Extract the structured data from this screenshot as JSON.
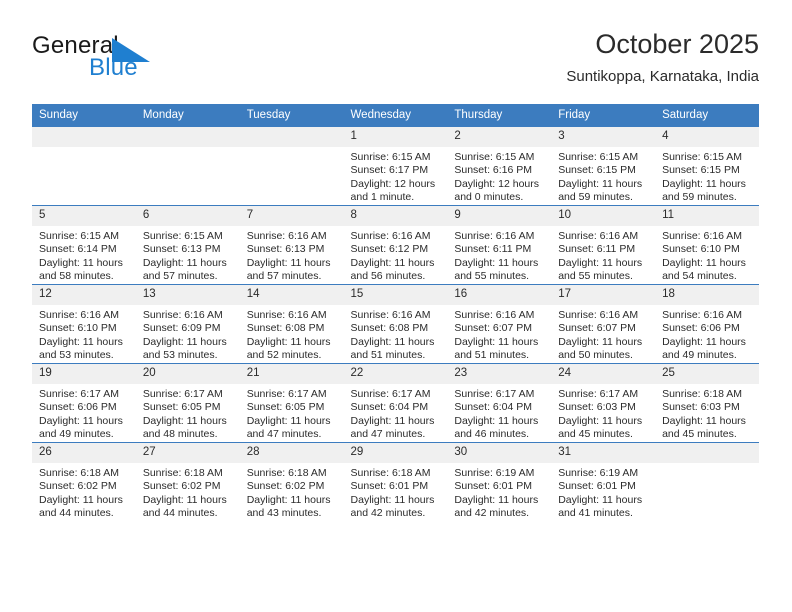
{
  "brand": {
    "word1": "General",
    "word2": "Blue",
    "triangle_color": "#1f7fd0",
    "word1_color": "#1a1a1a",
    "word2_color": "#1f7fd0"
  },
  "header": {
    "title": "October 2025",
    "subtitle": "Suntikoppa, Karnataka, India"
  },
  "theme": {
    "header_bg": "#3c7cbf",
    "header_text": "#ffffff",
    "daynum_bg": "#f0f0f0",
    "cell_bg": "#ffffff",
    "separator": "#3c7cbf",
    "text": "#2b2b2b"
  },
  "weekday_headers": [
    "Sunday",
    "Monday",
    "Tuesday",
    "Wednesday",
    "Thursday",
    "Friday",
    "Saturday"
  ],
  "labels": {
    "sunrise_prefix": "Sunrise:",
    "sunset_prefix": "Sunset:",
    "daylight_prefix": "Daylight:"
  },
  "weeks": [
    [
      {
        "day": "",
        "blank": true,
        "sunrise": "",
        "sunset": "",
        "daylight": ""
      },
      {
        "day": "",
        "blank": true,
        "sunrise": "",
        "sunset": "",
        "daylight": ""
      },
      {
        "day": "",
        "blank": true,
        "sunrise": "",
        "sunset": "",
        "daylight": ""
      },
      {
        "day": "1",
        "blank": false,
        "sunrise": "Sunrise: 6:15 AM",
        "sunset": "Sunset: 6:17 PM",
        "daylight": "Daylight: 12 hours and 1 minute."
      },
      {
        "day": "2",
        "blank": false,
        "sunrise": "Sunrise: 6:15 AM",
        "sunset": "Sunset: 6:16 PM",
        "daylight": "Daylight: 12 hours and 0 minutes."
      },
      {
        "day": "3",
        "blank": false,
        "sunrise": "Sunrise: 6:15 AM",
        "sunset": "Sunset: 6:15 PM",
        "daylight": "Daylight: 11 hours and 59 minutes."
      },
      {
        "day": "4",
        "blank": false,
        "sunrise": "Sunrise: 6:15 AM",
        "sunset": "Sunset: 6:15 PM",
        "daylight": "Daylight: 11 hours and 59 minutes."
      }
    ],
    [
      {
        "day": "5",
        "blank": false,
        "sunrise": "Sunrise: 6:15 AM",
        "sunset": "Sunset: 6:14 PM",
        "daylight": "Daylight: 11 hours and 58 minutes."
      },
      {
        "day": "6",
        "blank": false,
        "sunrise": "Sunrise: 6:15 AM",
        "sunset": "Sunset: 6:13 PM",
        "daylight": "Daylight: 11 hours and 57 minutes."
      },
      {
        "day": "7",
        "blank": false,
        "sunrise": "Sunrise: 6:16 AM",
        "sunset": "Sunset: 6:13 PM",
        "daylight": "Daylight: 11 hours and 57 minutes."
      },
      {
        "day": "8",
        "blank": false,
        "sunrise": "Sunrise: 6:16 AM",
        "sunset": "Sunset: 6:12 PM",
        "daylight": "Daylight: 11 hours and 56 minutes."
      },
      {
        "day": "9",
        "blank": false,
        "sunrise": "Sunrise: 6:16 AM",
        "sunset": "Sunset: 6:11 PM",
        "daylight": "Daylight: 11 hours and 55 minutes."
      },
      {
        "day": "10",
        "blank": false,
        "sunrise": "Sunrise: 6:16 AM",
        "sunset": "Sunset: 6:11 PM",
        "daylight": "Daylight: 11 hours and 55 minutes."
      },
      {
        "day": "11",
        "blank": false,
        "sunrise": "Sunrise: 6:16 AM",
        "sunset": "Sunset: 6:10 PM",
        "daylight": "Daylight: 11 hours and 54 minutes."
      }
    ],
    [
      {
        "day": "12",
        "blank": false,
        "sunrise": "Sunrise: 6:16 AM",
        "sunset": "Sunset: 6:10 PM",
        "daylight": "Daylight: 11 hours and 53 minutes."
      },
      {
        "day": "13",
        "blank": false,
        "sunrise": "Sunrise: 6:16 AM",
        "sunset": "Sunset: 6:09 PM",
        "daylight": "Daylight: 11 hours and 53 minutes."
      },
      {
        "day": "14",
        "blank": false,
        "sunrise": "Sunrise: 6:16 AM",
        "sunset": "Sunset: 6:08 PM",
        "daylight": "Daylight: 11 hours and 52 minutes."
      },
      {
        "day": "15",
        "blank": false,
        "sunrise": "Sunrise: 6:16 AM",
        "sunset": "Sunset: 6:08 PM",
        "daylight": "Daylight: 11 hours and 51 minutes."
      },
      {
        "day": "16",
        "blank": false,
        "sunrise": "Sunrise: 6:16 AM",
        "sunset": "Sunset: 6:07 PM",
        "daylight": "Daylight: 11 hours and 51 minutes."
      },
      {
        "day": "17",
        "blank": false,
        "sunrise": "Sunrise: 6:16 AM",
        "sunset": "Sunset: 6:07 PM",
        "daylight": "Daylight: 11 hours and 50 minutes."
      },
      {
        "day": "18",
        "blank": false,
        "sunrise": "Sunrise: 6:16 AM",
        "sunset": "Sunset: 6:06 PM",
        "daylight": "Daylight: 11 hours and 49 minutes."
      }
    ],
    [
      {
        "day": "19",
        "blank": false,
        "sunrise": "Sunrise: 6:17 AM",
        "sunset": "Sunset: 6:06 PM",
        "daylight": "Daylight: 11 hours and 49 minutes."
      },
      {
        "day": "20",
        "blank": false,
        "sunrise": "Sunrise: 6:17 AM",
        "sunset": "Sunset: 6:05 PM",
        "daylight": "Daylight: 11 hours and 48 minutes."
      },
      {
        "day": "21",
        "blank": false,
        "sunrise": "Sunrise: 6:17 AM",
        "sunset": "Sunset: 6:05 PM",
        "daylight": "Daylight: 11 hours and 47 minutes."
      },
      {
        "day": "22",
        "blank": false,
        "sunrise": "Sunrise: 6:17 AM",
        "sunset": "Sunset: 6:04 PM",
        "daylight": "Daylight: 11 hours and 47 minutes."
      },
      {
        "day": "23",
        "blank": false,
        "sunrise": "Sunrise: 6:17 AM",
        "sunset": "Sunset: 6:04 PM",
        "daylight": "Daylight: 11 hours and 46 minutes."
      },
      {
        "day": "24",
        "blank": false,
        "sunrise": "Sunrise: 6:17 AM",
        "sunset": "Sunset: 6:03 PM",
        "daylight": "Daylight: 11 hours and 45 minutes."
      },
      {
        "day": "25",
        "blank": false,
        "sunrise": "Sunrise: 6:18 AM",
        "sunset": "Sunset: 6:03 PM",
        "daylight": "Daylight: 11 hours and 45 minutes."
      }
    ],
    [
      {
        "day": "26",
        "blank": false,
        "sunrise": "Sunrise: 6:18 AM",
        "sunset": "Sunset: 6:02 PM",
        "daylight": "Daylight: 11 hours and 44 minutes."
      },
      {
        "day": "27",
        "blank": false,
        "sunrise": "Sunrise: 6:18 AM",
        "sunset": "Sunset: 6:02 PM",
        "daylight": "Daylight: 11 hours and 44 minutes."
      },
      {
        "day": "28",
        "blank": false,
        "sunrise": "Sunrise: 6:18 AM",
        "sunset": "Sunset: 6:02 PM",
        "daylight": "Daylight: 11 hours and 43 minutes."
      },
      {
        "day": "29",
        "blank": false,
        "sunrise": "Sunrise: 6:18 AM",
        "sunset": "Sunset: 6:01 PM",
        "daylight": "Daylight: 11 hours and 42 minutes."
      },
      {
        "day": "30",
        "blank": false,
        "sunrise": "Sunrise: 6:19 AM",
        "sunset": "Sunset: 6:01 PM",
        "daylight": "Daylight: 11 hours and 42 minutes."
      },
      {
        "day": "31",
        "blank": false,
        "sunrise": "Sunrise: 6:19 AM",
        "sunset": "Sunset: 6:01 PM",
        "daylight": "Daylight: 11 hours and 41 minutes."
      },
      {
        "day": "",
        "blank": true,
        "sunrise": "",
        "sunset": "",
        "daylight": ""
      }
    ]
  ]
}
